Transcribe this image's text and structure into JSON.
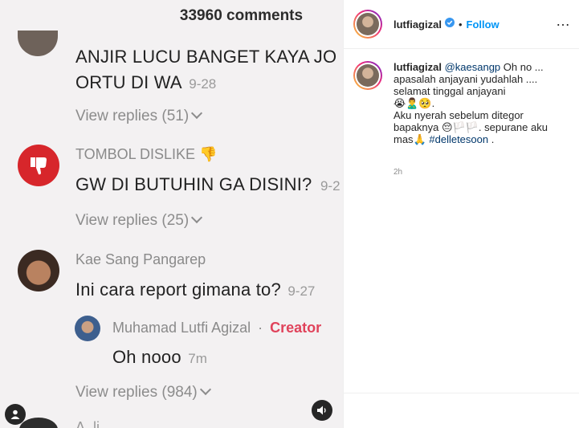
{
  "media": {
    "comments_count": "33960 comments",
    "comments": [
      {
        "text_line1": "ANJIR LUCU BANGET KAYA JO",
        "text_line2": "ORTU DI WA",
        "date": "9-28",
        "replies": "View replies (51)"
      },
      {
        "name": "TOMBOL DISLIKE 👎",
        "text": "GW DI BUTUHIN GA DISINI?",
        "date": "9-2",
        "replies": "View replies (25)"
      },
      {
        "name": "Kae Sang Pangarep",
        "text": "Ini cara report gimana to?",
        "date": "9-27",
        "reply": {
          "name": "Muhamad Lutfi Agizal",
          "sep": "·",
          "badge": "Creator",
          "text": "Oh nooo",
          "date": "7m"
        },
        "replies": "View replies (984)"
      }
    ],
    "partial_name": "A..li.."
  },
  "post": {
    "username": "lutfiagizal",
    "separator": "•",
    "follow_label": "Follow",
    "more_label": "…",
    "caption": {
      "username": "lutfiagizal",
      "mention": "@kaesangp",
      "line1": " Oh no ... apasalah anjayani yudahlah .... selamat tinggal anjayani",
      "emoji1": "😭🙎‍♂️🥺.",
      "line2": "Aku nyerah sebelum ditegor bapaknya 😔🏳️🏳️. sepurane aku mas🙏",
      "hashtag": "#delletesoon",
      "end": " ."
    },
    "time": "2h"
  }
}
